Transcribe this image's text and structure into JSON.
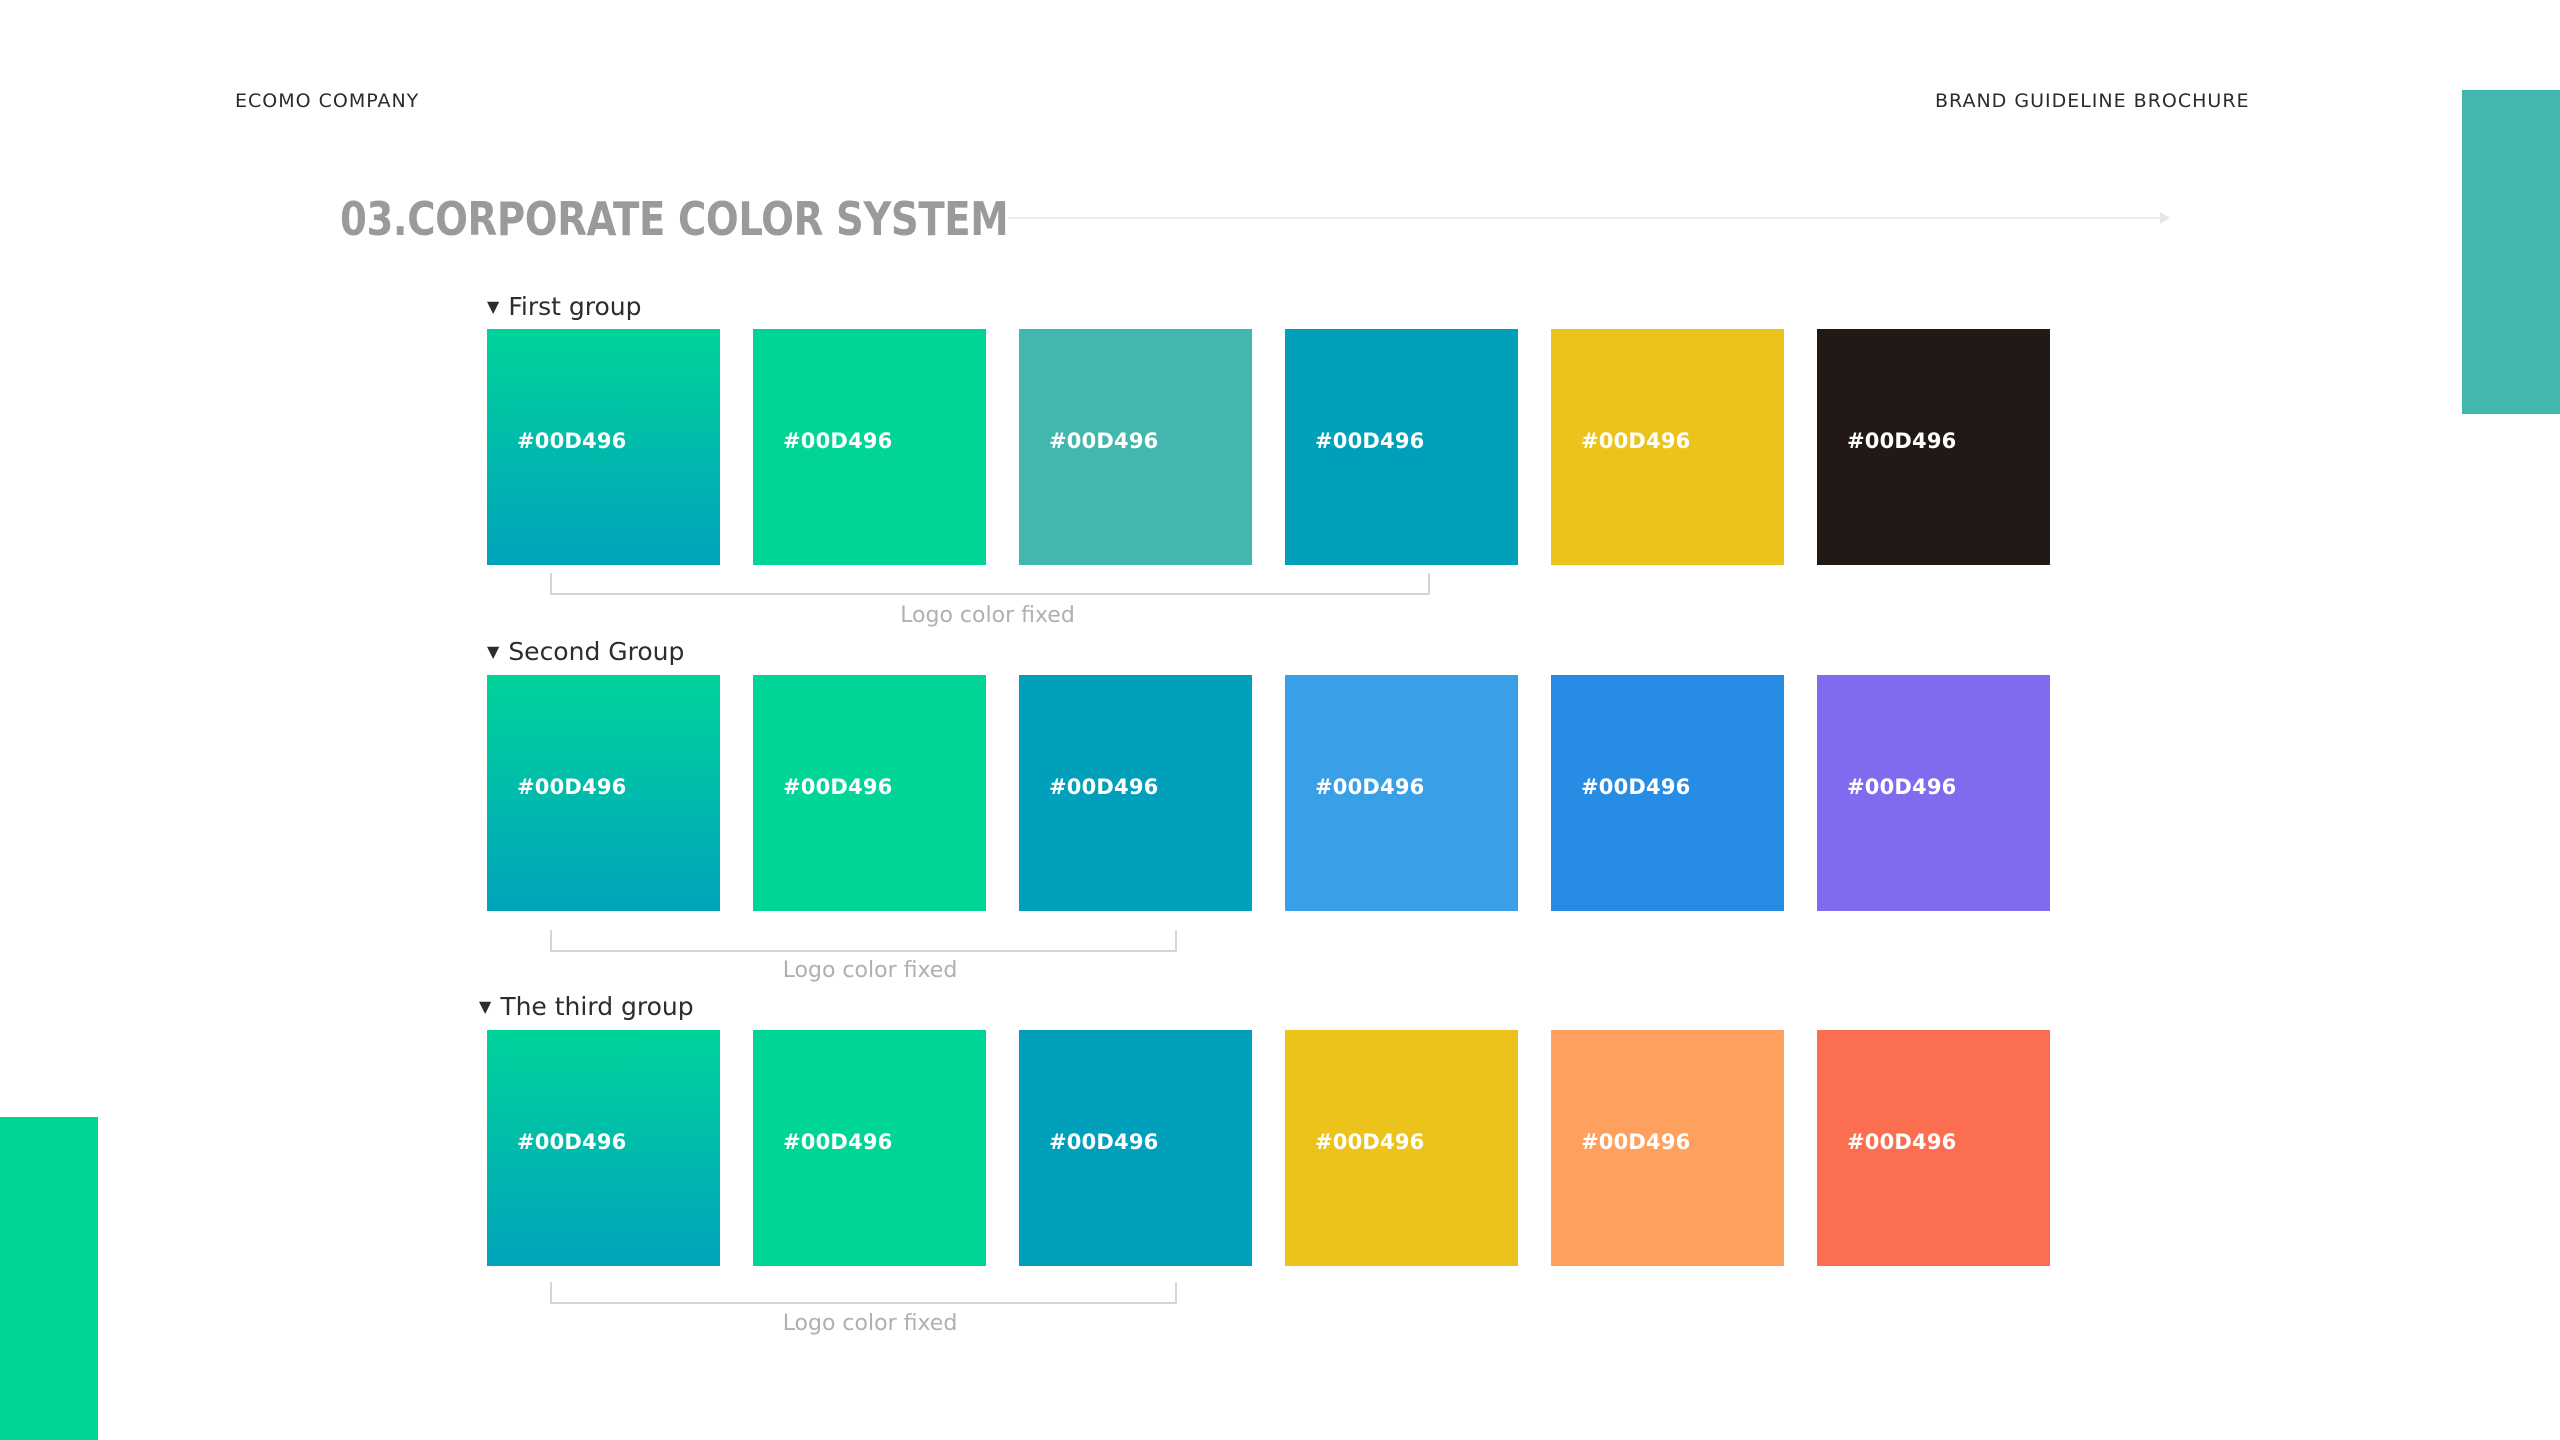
{
  "header": {
    "company": "ECOMO COMPANY",
    "doc_type": "BRAND GUIDELINE BROCHURE"
  },
  "title": "03.CORPORATE COLOR SYSTEM",
  "colors": {
    "deco_right": "#42B7AD",
    "deco_left": "#00D496"
  },
  "groups": [
    {
      "label": "First group",
      "swatches": [
        {
          "hex": "#00D496",
          "fill": "linear-gradient(180deg, #00d39a 0%, #00a3bb 100%)"
        },
        {
          "hex": "#00D496",
          "fill": "#00d496"
        },
        {
          "hex": "#00D496",
          "fill": "#42b7ad"
        },
        {
          "hex": "#00D496",
          "fill": "#00a0ba"
        },
        {
          "hex": "#00D496",
          "fill": "#ecc31b"
        },
        {
          "hex": "#00D496",
          "fill": "#221816"
        }
      ],
      "bracket_label": "Logo color fixed"
    },
    {
      "label": "Second Group",
      "swatches": [
        {
          "hex": "#00D496",
          "fill": "linear-gradient(180deg, #00d39a 0%, #00a3bb 100%)"
        },
        {
          "hex": "#00D496",
          "fill": "#00d496"
        },
        {
          "hex": "#00D496",
          "fill": "#00a0ba"
        },
        {
          "hex": "#00D496",
          "fill": "#399fe6"
        },
        {
          "hex": "#00D496",
          "fill": "#278de4"
        },
        {
          "hex": "#00D496",
          "fill": "#806bee"
        }
      ],
      "bracket_label": "Logo color fixed"
    },
    {
      "label": "The third group",
      "swatches": [
        {
          "hex": "#00D496",
          "fill": "linear-gradient(180deg, #00d39a 0%, #00a3bb 100%)"
        },
        {
          "hex": "#00D496",
          "fill": "#00d496"
        },
        {
          "hex": "#00D496",
          "fill": "#00a0ba"
        },
        {
          "hex": "#00D496",
          "fill": "#ecc31b"
        },
        {
          "hex": "#00D496",
          "fill": "#ffa05f"
        },
        {
          "hex": "#00D496",
          "fill": "#fb6f50"
        }
      ],
      "bracket_label": "Logo color fixed"
    }
  ]
}
